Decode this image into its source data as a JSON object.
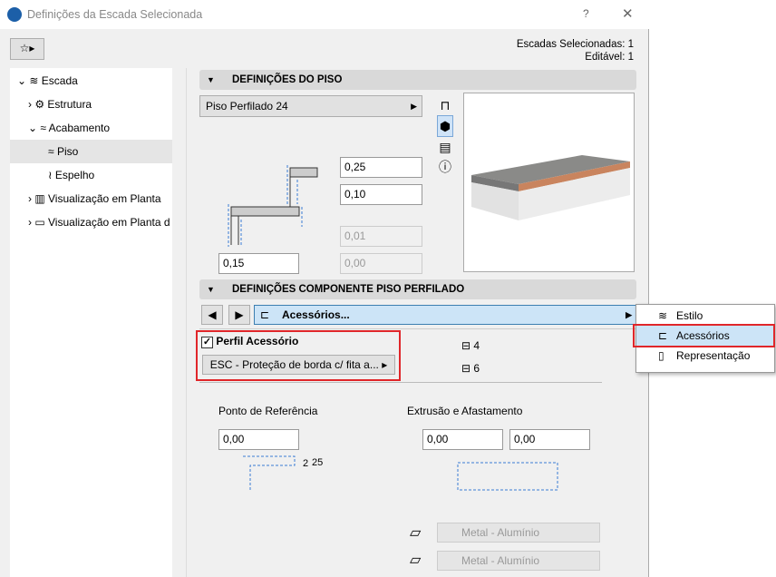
{
  "window": {
    "title": "Definições da Escada Selecionada",
    "help": "?",
    "close": "✕"
  },
  "info": {
    "selected": "Escadas Selecionadas: 1",
    "editable": "Editável: 1"
  },
  "tree": [
    {
      "label": "Escada"
    },
    {
      "label": "Estrutura"
    },
    {
      "label": "Acabamento"
    },
    {
      "label": "Piso"
    },
    {
      "label": "Espelho"
    },
    {
      "label": "Visualização em Planta"
    },
    {
      "label": "Visualização em Planta d"
    }
  ],
  "floor": {
    "header": "DEFINIÇÕES DO PISO",
    "type": "Piso Perfilado 24",
    "v1": "0,25",
    "v2": "0,10",
    "v3": "0,01",
    "v4": "0,00",
    "v5": "0,15"
  },
  "component": {
    "header": "DEFINIÇÕES COMPONENTE PISO PERFILADO",
    "selector": "Acessórios...",
    "profile_label": "Perfil Acessório",
    "profile_value": "ESC - Proteção de borda c/ fita a...",
    "n1": "4",
    "n2": "6"
  },
  "ref": {
    "label": "Ponto de Referência",
    "value": "0,00",
    "dim": "25"
  },
  "extr": {
    "label": "Extrusão e Afastamento",
    "v1": "0,00",
    "v2": "0,00"
  },
  "materials": [
    "Metal - Alumínio",
    "Metal - Alumínio"
  ],
  "menu": [
    "Estilo",
    "Acessórios",
    "Representação"
  ]
}
